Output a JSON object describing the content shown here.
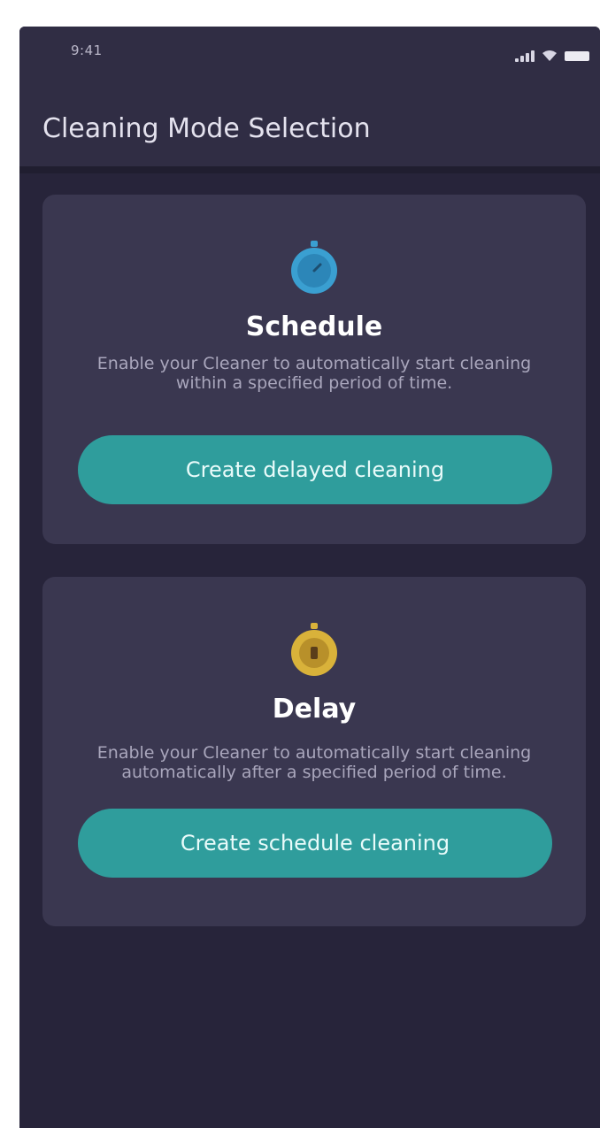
{
  "status_bar": {
    "time": "9:41"
  },
  "header": {
    "title": "Cleaning Mode Selection"
  },
  "cards": [
    {
      "icon": "stopwatch-icon",
      "icon_color": "#3a9fd1",
      "title": "Schedule",
      "description": "Enable your Cleaner to automatically start cleaning within a specified period of time.",
      "button_label": "Create delayed cleaning"
    },
    {
      "icon": "timer-icon",
      "icon_color": "#d9b23a",
      "title": "Delay",
      "description": "Enable your Cleaner to automatically start cleaning automatically after a specified period of time.",
      "button_label": "Create schedule cleaning"
    }
  ],
  "colors": {
    "background": "#27243a",
    "card": "#3a3750",
    "accent": "#2f9d9c"
  }
}
